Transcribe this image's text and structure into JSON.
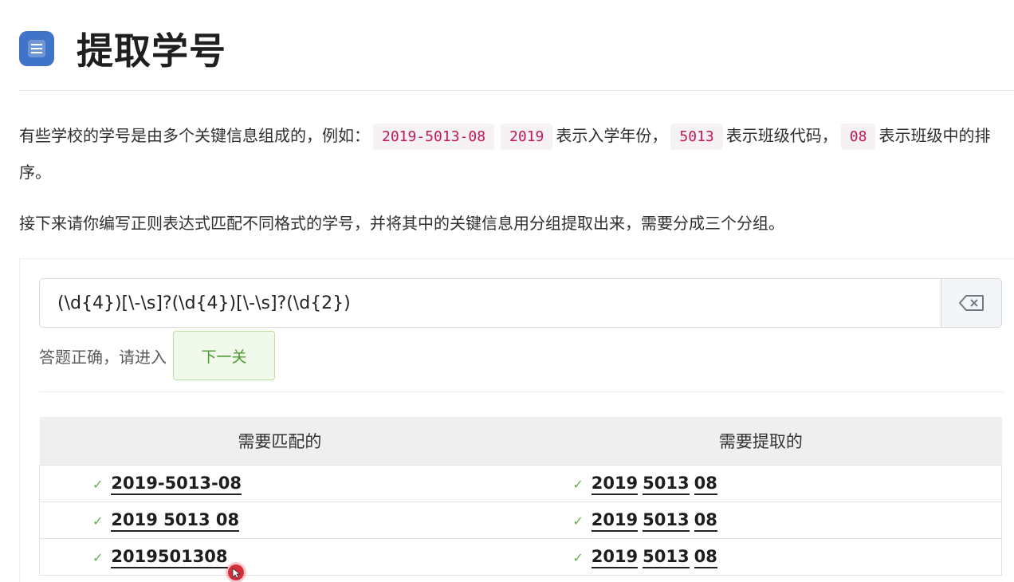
{
  "page": {
    "title": "提取学号",
    "para1": {
      "prefix": "有些学校的学号是由多个关键信息组成的，例如：",
      "example": "2019-5013-08",
      "year_code": "2019",
      "year_text": "表示入学年份，",
      "class_code": "5013",
      "class_text": "表示班级代码，",
      "order_code": "08",
      "order_text": "表示班级中的排序。"
    },
    "para2": "接下来请你编写正则表达式匹配不同格式的学号，并将其中的关键信息用分组提取出来，需要分成三个分组。"
  },
  "editor": {
    "regex_value": "(\\d{4})[\\-\\s]?(\\d{4})[\\-\\s]?(\\d{2})",
    "clear_icon": "backspace-icon",
    "status_text": "答题正确，请进入",
    "next_label": "下一关"
  },
  "table": {
    "headers": [
      "需要匹配的",
      "需要提取的"
    ],
    "rows": [
      {
        "match": "2019-5013-08",
        "groups": [
          "2019",
          "5013",
          "08"
        ]
      },
      {
        "match": "2019 5013 08",
        "groups": [
          "2019",
          "5013",
          "08"
        ]
      },
      {
        "match": "2019501308",
        "groups": [
          "2019",
          "5013",
          "08"
        ]
      }
    ],
    "check_icon": "✓"
  },
  "colors": {
    "accent_blue": "#3f74c9",
    "code_red": "#c2185b",
    "success_green": "#4a9d2c",
    "cursor_red": "#d52d3a"
  }
}
